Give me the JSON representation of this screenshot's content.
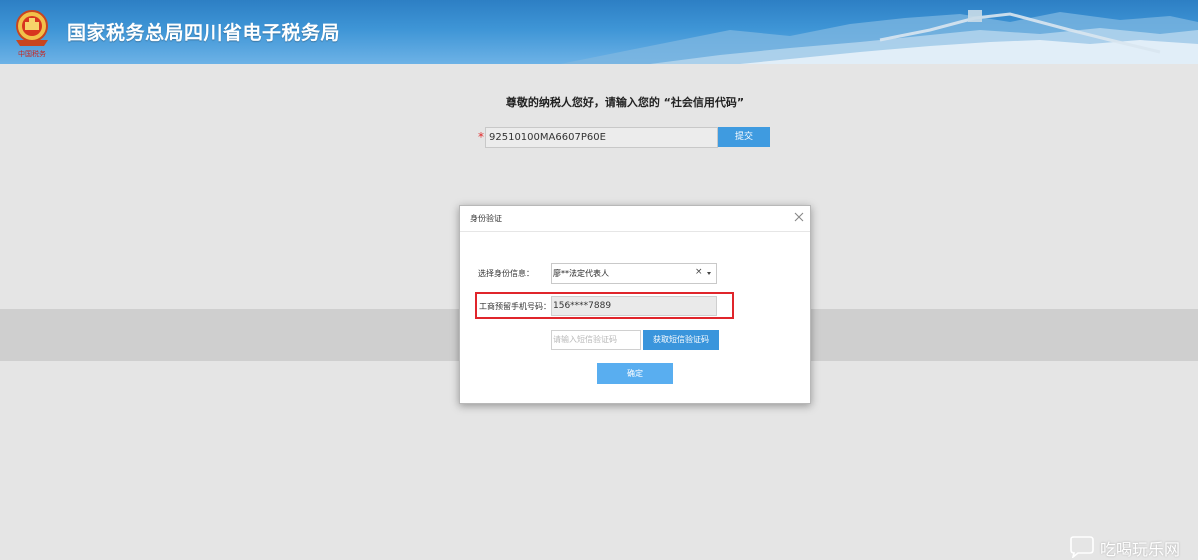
{
  "header": {
    "title": "国家税务总局四川省电子税务局",
    "emblem_caption": "中国税务"
  },
  "main": {
    "greeting": "尊敬的纳税人您好，请输入您的 “社会信用代码”",
    "required_mark": "*",
    "credit_code_value": "92510100MA6607P60E",
    "submit_label": "提交"
  },
  "modal": {
    "title": "身份验证",
    "identity_label": "选择身份信息：",
    "identity_selected": "廖**法定代表人",
    "clear_symbol": "×",
    "phone_label": "工商预留手机号码：",
    "phone_value": "156****7889",
    "sms_placeholder": "请输入短信验证码",
    "get_code_label": "获取短信验证码",
    "confirm_label": "确定"
  },
  "watermark": {
    "text": "吃喝玩乐网"
  },
  "colors": {
    "header_blue": "#2d7fc4",
    "button_blue": "#3f9be0",
    "confirm_blue": "#59aef0",
    "highlight_red": "#e0252b",
    "required_red": "#e02b2b"
  },
  "icons": {
    "emblem": "tax-emblem-icon",
    "close": "close-icon",
    "dropdown": "chevron-down-icon",
    "watermark": "chat-bubble-icon"
  }
}
